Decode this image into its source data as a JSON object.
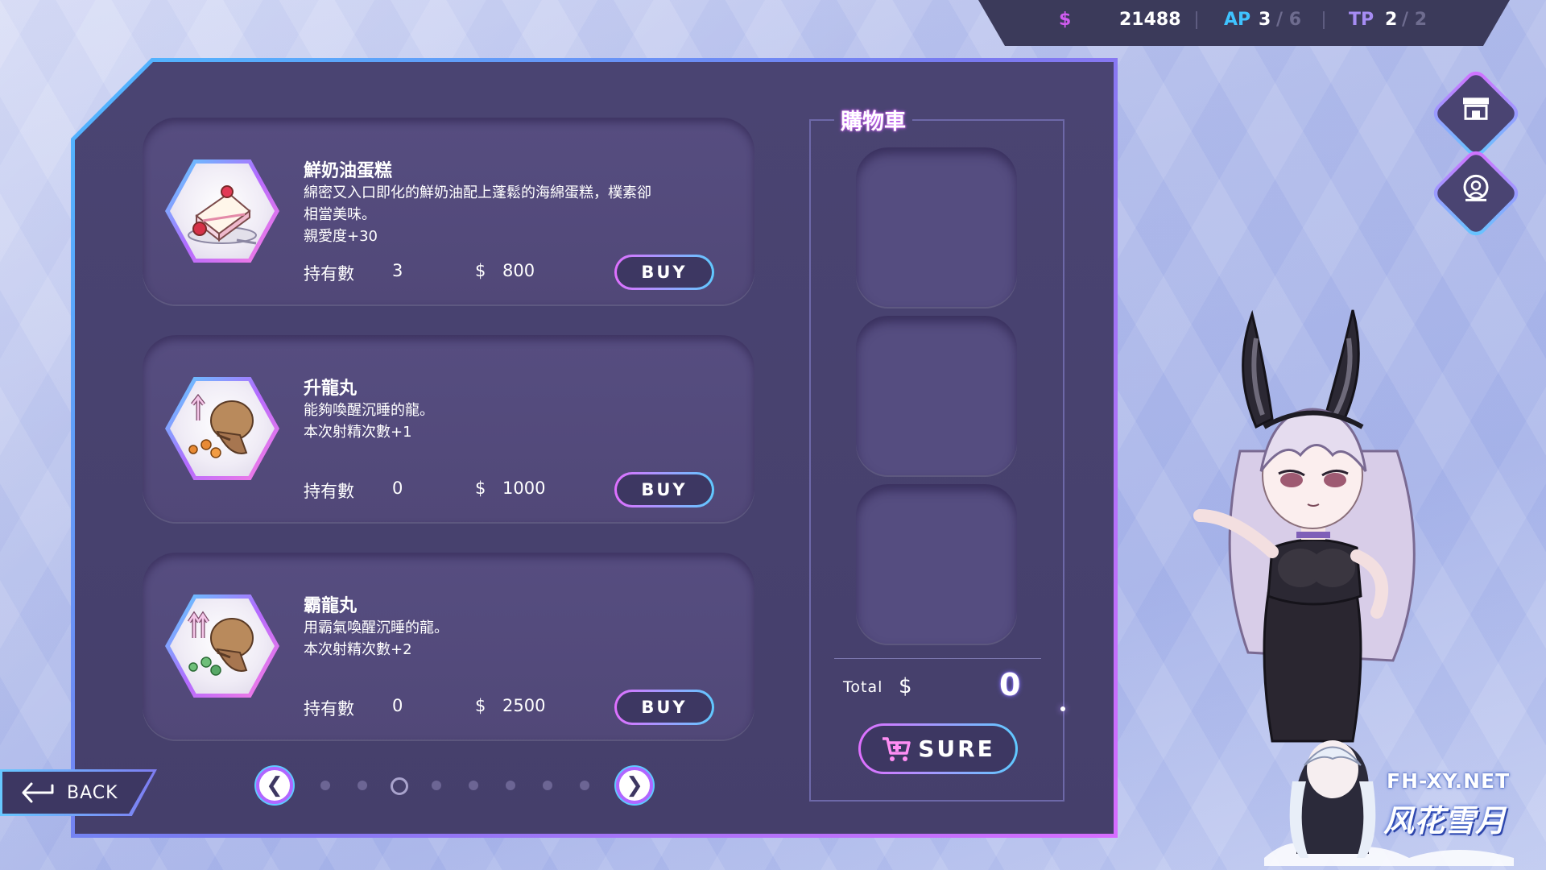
{
  "status_bar": {
    "money_icon": "$",
    "money": "21488",
    "ap_label": "AP",
    "ap_value": "3",
    "ap_max": "/ 6",
    "tp_label": "TP",
    "tp_value": "2",
    "tp_max": "/ 2"
  },
  "shop": {
    "owned_label": "持有數",
    "currency_symbol": "$",
    "buy_label": "BUY",
    "items": [
      {
        "name": "鮮奶油蛋糕",
        "desc_lines": [
          "綿密又入口即化的鮮奶油配上蓬鬆的海綿蛋糕，樸素卻",
          "相當美味。",
          "親愛度+30"
        ],
        "owned": "3",
        "price": "800",
        "icon": "cake-icon"
      },
      {
        "name": "升龍丸",
        "desc_lines": [
          "能夠喚醒沉睡的龍。",
          "本次射精次數+1",
          ""
        ],
        "owned": "0",
        "price": "1000",
        "icon": "pill-bag-single-arrow-icon"
      },
      {
        "name": "霸龍丸",
        "desc_lines": [
          "用霸氣喚醒沉睡的龍。",
          "本次射精次數+2",
          ""
        ],
        "owned": "0",
        "price": "2500",
        "icon": "pill-bag-double-arrow-icon"
      }
    ]
  },
  "pagination": {
    "prev_icon": "chevron-left-icon",
    "next_icon": "chevron-right-icon",
    "page_count": 8,
    "current_page": 3
  },
  "cart": {
    "title": "購物車",
    "total_label": "Total",
    "total_currency": "$",
    "total_value": "0",
    "sure_label": "SURE",
    "slots": 3
  },
  "back_button": {
    "label": "BACK",
    "icon": "back-arrow-icon"
  },
  "side_icons": [
    "shop-icon",
    "character-icon"
  ],
  "watermark": {
    "url": "FH-XY.NET",
    "name": "风花雪月"
  },
  "colors": {
    "accent_pink": "#d76dff",
    "accent_blue": "#5fc9ff",
    "panel_bg": "#4a4472",
    "money_color": "#d15cf0",
    "ap_color": "#3fc3ff",
    "tp_color": "#a68cf3"
  }
}
